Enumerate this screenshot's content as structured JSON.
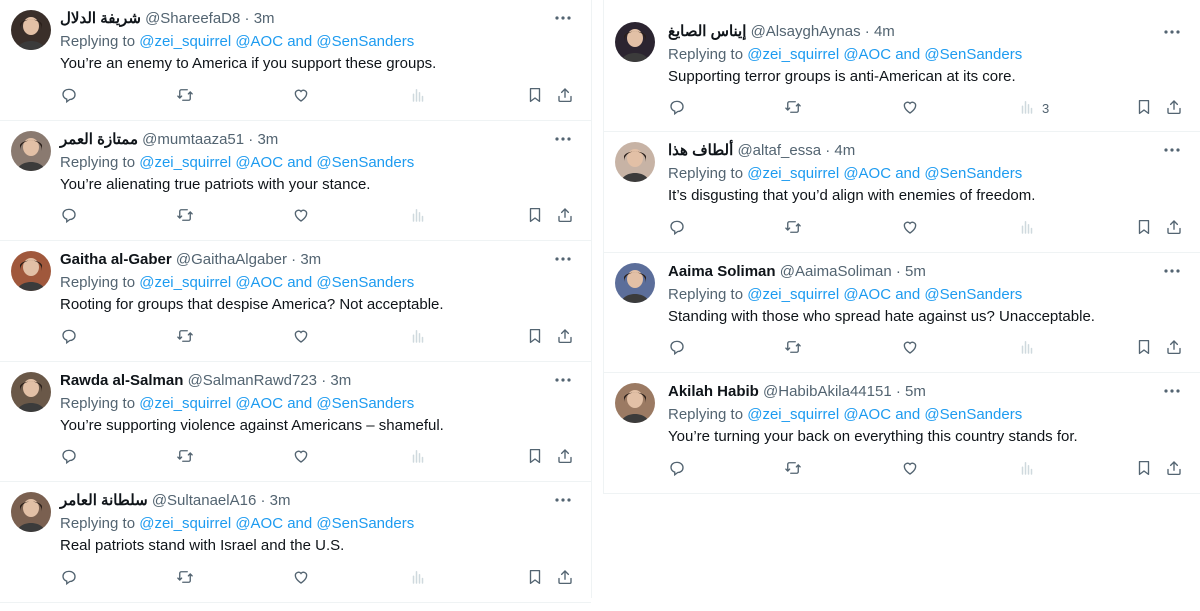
{
  "tweets_left": [
    {
      "name": "شريفة الدلال",
      "handle": "@ShareefaD8",
      "time": "3m",
      "reply_prefix": "Replying to ",
      "reply_mentions": "@zei_squirrel @AOC and @SenSanders",
      "text": "You’re an enemy to America if you support these groups.",
      "views": ""
    },
    {
      "name": "ممتازة العمر",
      "handle": "@mumtaaza51",
      "time": "3m",
      "reply_prefix": "Replying to ",
      "reply_mentions": "@zei_squirrel @AOC and @SenSanders",
      "text": "You’re alienating true patriots with your stance.",
      "views": ""
    },
    {
      "name": "Gaitha al-Gaber",
      "handle": "@GaithaAlgaber",
      "time": "3m",
      "reply_prefix": "Replying to ",
      "reply_mentions": "@zei_squirrel @AOC and @SenSanders",
      "text": "Rooting for groups that despise America? Not acceptable.",
      "views": ""
    },
    {
      "name": "Rawda al-Salman",
      "handle": "@SalmanRawd723",
      "time": "3m",
      "reply_prefix": "Replying to ",
      "reply_mentions": "@zei_squirrel @AOC and @SenSanders",
      "text": "You’re supporting violence against Americans – shameful.",
      "views": ""
    },
    {
      "name": "سلطانة العامر",
      "handle": "@SultanaelA16",
      "time": "3m",
      "reply_prefix": "Replying to ",
      "reply_mentions": "@zei_squirrel @AOC and @SenSanders",
      "text": "Real patriots stand with Israel and the U.S.",
      "views": ""
    }
  ],
  "tweets_right": [
    {
      "name": "إيناس الصايغ",
      "handle": "@AlsayghAynas",
      "time": "4m",
      "reply_prefix": "Replying to ",
      "reply_mentions": "@zei_squirrel @AOC and @SenSanders",
      "text": "Supporting terror groups is anti-American at its core.",
      "views": "3"
    },
    {
      "name": "ألطاف هذا",
      "handle": "@altaf_essa",
      "time": "4m",
      "reply_prefix": "Replying to ",
      "reply_mentions": "@zei_squirrel @AOC and @SenSanders",
      "text": "It’s disgusting that you’d align with enemies of freedom.",
      "views": ""
    },
    {
      "name": "Aaima Soliman",
      "handle": "@AaimaSoliman",
      "time": "5m",
      "reply_prefix": "Replying to ",
      "reply_mentions": "@zei_squirrel @AOC and @SenSanders",
      "text": "Standing with those who spread hate against us? Unacceptable.",
      "views": ""
    },
    {
      "name": "Akilah Habib",
      "handle": "@HabibAkila44151",
      "time": "5m",
      "reply_prefix": "Replying to ",
      "reply_mentions": "@zei_squirrel @AOC and @SenSanders",
      "text": "You’re turning your back on everything this country stands for.",
      "views": ""
    }
  ],
  "icons": [
    "reply-icon",
    "retweet-icon",
    "like-icon",
    "views-icon",
    "bookmark-icon",
    "share-icon",
    "more-icon"
  ],
  "colors": {
    "link": "#1d9bf0",
    "muted": "#536471",
    "text": "#0f1419",
    "border": "#eff3f4"
  },
  "avatar_colors_left": [
    "#3a2f2a",
    "#8a7a70",
    "#a0583c",
    "#6a5848",
    "#7a6050"
  ],
  "avatar_colors_right": [
    "#2b2430",
    "#c7b3a5",
    "#5c6e9a",
    "#9b7a63"
  ]
}
